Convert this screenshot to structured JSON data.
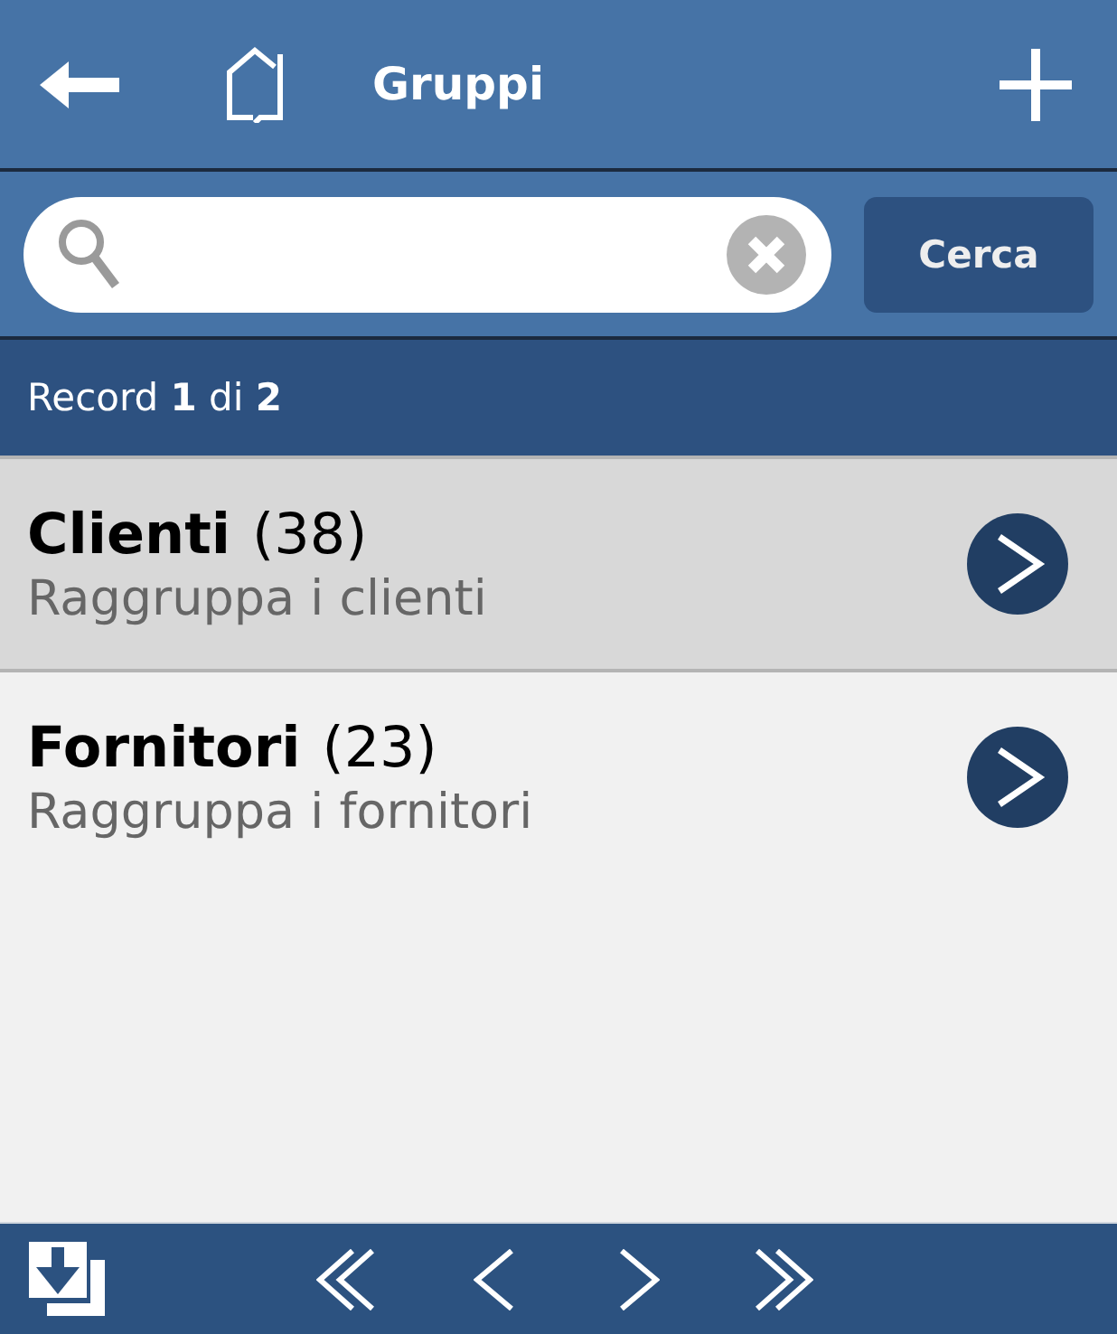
{
  "header": {
    "title": "Gruppi"
  },
  "search": {
    "button": "Cerca"
  },
  "record_bar": {
    "text": "Record **1** di **2**"
  },
  "groups": [
    {
      "name": "Clienti",
      "count": "(38)",
      "description": "Raggruppa i clienti",
      "selected": true
    },
    {
      "name": "Fornitori",
      "count": "(23)",
      "description": "Raggruppa i fornitori",
      "selected": false
    }
  ]
}
